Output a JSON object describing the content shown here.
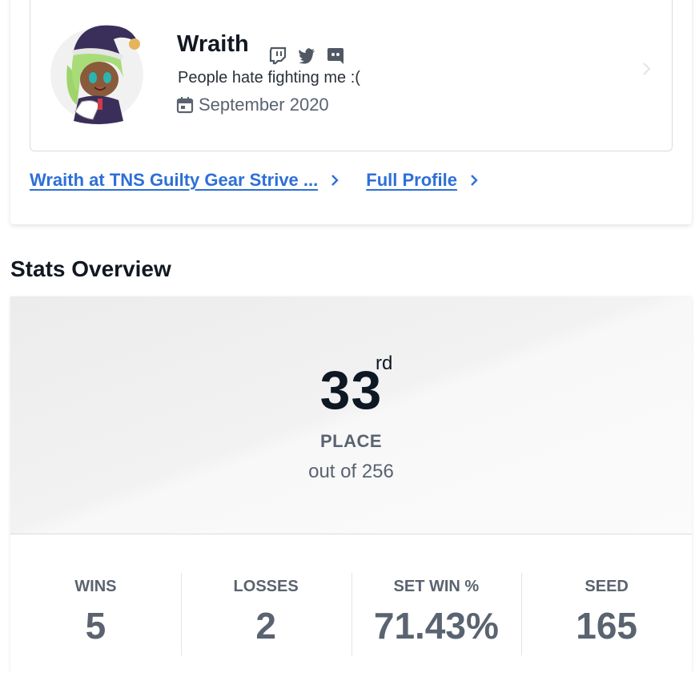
{
  "profile": {
    "name": "Wraith",
    "bio": "People hate fighting me :(",
    "joined": "September 2020",
    "socials": [
      "twitch-icon",
      "twitter-icon",
      "discord-icon"
    ]
  },
  "links": {
    "event_link": "Wraith at TNS Guilty Gear Strive ...",
    "profile_link": "Full Profile"
  },
  "stats": {
    "section_title": "Stats Overview",
    "placement": "33",
    "placement_suffix": "rd",
    "place_label": "PLACE",
    "out_of": "out of 256",
    "items": [
      {
        "label": "WINS",
        "value": "5"
      },
      {
        "label": "LOSSES",
        "value": "2"
      },
      {
        "label": "SET WIN %",
        "value": "71.43%"
      },
      {
        "label": "SEED",
        "value": "165"
      }
    ]
  },
  "colors": {
    "link": "#2e6fd8",
    "heading": "#111821",
    "muted": "#5a6370"
  }
}
